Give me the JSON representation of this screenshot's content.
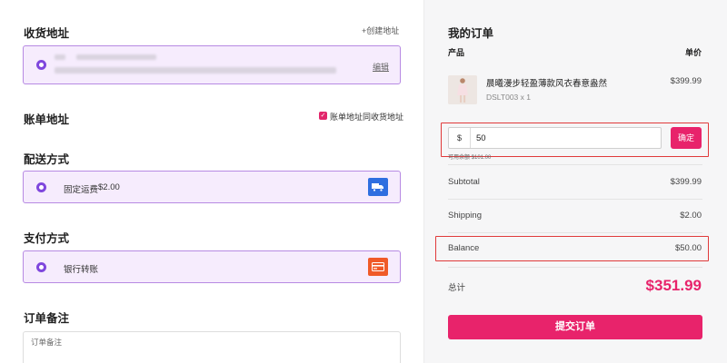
{
  "shipping_address": {
    "title": "收货地址",
    "create_link": "+创建地址",
    "edit_link": "编辑"
  },
  "billing_address": {
    "title": "账单地址",
    "same_as_shipping_label": "账单地址同收货地址",
    "same_as_shipping_checked": true
  },
  "delivery": {
    "title": "配送方式",
    "option_label": "固定运费",
    "option_price": "$2.00",
    "icon": "truck-icon",
    "icon_color": "#2f6fe0"
  },
  "payment": {
    "title": "支付方式",
    "option_label": "银行转账",
    "icon": "card-icon",
    "icon_color": "#f05a28"
  },
  "notes": {
    "title": "订单备注",
    "placeholder": "订单备注"
  },
  "order": {
    "title": "我的订单",
    "col_product": "产品",
    "col_price": "单价",
    "product": {
      "name": "晨曦漫步轻盈薄款风衣春意盎然",
      "sku_qty": "DSLT003 x 1",
      "price": "$399.99"
    },
    "coupon": {
      "currency": "$",
      "value": "50",
      "confirm_label": "确定",
      "hint": "可用余额 $101.00"
    },
    "subtotal_label": "Subtotal",
    "subtotal_value": "$399.99",
    "shipping_label": "Shipping",
    "shipping_value": "$2.00",
    "balance_label": "Balance",
    "balance_value": "$50.00",
    "total_label": "总计",
    "total_value": "$351.99",
    "submit_label": "提交订单"
  },
  "colors": {
    "accent": "#e8236b",
    "selected_border": "#b78ae3",
    "selected_bg": "#f6ecfd",
    "radio": "#7f47dd",
    "highlight": "#e03a3a"
  }
}
